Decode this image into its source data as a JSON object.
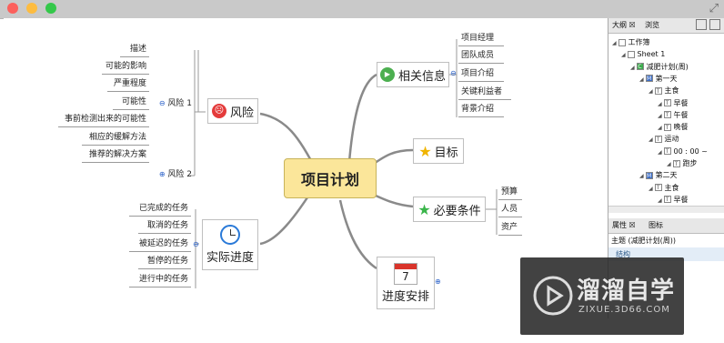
{
  "colors": {
    "root_fill": "#fbe69a",
    "titlebar": "#c9c9c9",
    "close": "#fc605c",
    "min": "#fdbc40",
    "max": "#34c84a"
  },
  "mindmap": {
    "root": "项目计划",
    "risk": {
      "label": "风险",
      "icon": "angry-face-icon",
      "sub1": "风险 1",
      "sub2": "风险 2",
      "items": [
        "描述",
        "可能的影响",
        "严重程度",
        "可能性",
        "事前检测出来的可能性",
        "相应的缓解方法",
        "推荐的解决方案"
      ]
    },
    "progress": {
      "label": "实际进度",
      "icon": "clock-icon",
      "items": [
        "已完成的任务",
        "取消的任务",
        "被延迟的任务",
        "暂停的任务",
        "进行中的任务"
      ]
    },
    "info": {
      "label": "相关信息",
      "icon": "play-icon",
      "items": [
        "项目经理",
        "团队成员",
        "项目介绍",
        "关键利益者",
        "背景介绍"
      ]
    },
    "goal": {
      "label": "目标",
      "icon": "star-icon"
    },
    "req": {
      "label": "必要条件",
      "icon": "green-star-icon",
      "items": [
        "预算",
        "人员",
        "资产"
      ]
    },
    "schedule": {
      "label": "进度安排",
      "icon": "calendar-icon",
      "cal_number": "7"
    }
  },
  "outline": {
    "tab_outline": "大纲",
    "tab_browse": "浏览",
    "tree": [
      {
        "label": "工作簿",
        "level": 0
      },
      {
        "label": "Sheet 1",
        "level": 1
      },
      {
        "label": "减肥计划(周)",
        "level": 2,
        "badge": "C"
      },
      {
        "label": "第一天",
        "level": 3,
        "badge": "M"
      },
      {
        "label": "主食",
        "level": 4,
        "badge": "T"
      },
      {
        "label": "早餐",
        "level": 5,
        "badge": "T"
      },
      {
        "label": "午餐",
        "level": 5,
        "badge": "T"
      },
      {
        "label": "晚餐",
        "level": 5,
        "badge": "T"
      },
      {
        "label": "运动",
        "level": 4,
        "badge": "T"
      },
      {
        "label": "00 : 00 ~",
        "level": 5,
        "badge": "T"
      },
      {
        "label": "跑步",
        "level": 6,
        "badge": "T"
      },
      {
        "label": "第二天",
        "level": 3,
        "badge": "M"
      },
      {
        "label": "主食",
        "level": 4,
        "badge": "T"
      },
      {
        "label": "早餐",
        "level": 5,
        "badge": "T"
      }
    ]
  },
  "properties": {
    "tab_props": "属性",
    "tab_icons": "图标",
    "topic_line": "主题 (减肥计划(周))",
    "section": "结构"
  },
  "watermark": {
    "brand": "溜溜自学",
    "url": "ZIXUE.3D66.COM"
  }
}
